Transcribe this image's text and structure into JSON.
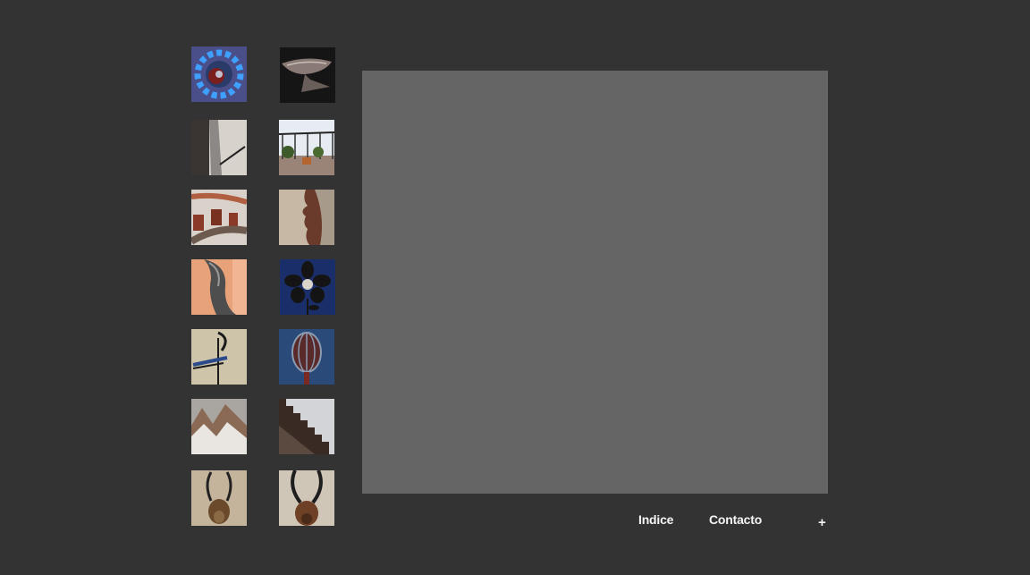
{
  "nav": {
    "index_label": "Indice",
    "contact_label": "Contacto",
    "more_label": "+"
  },
  "colors": {
    "background": "#333333",
    "viewer": "#656565",
    "link": "#f4f4f4"
  },
  "gallery": {
    "thumbnails": [
      {
        "subject": "blue-gear-sculpture"
      },
      {
        "subject": "metal-fish-sculpture"
      },
      {
        "subject": "metal-wall-relief"
      },
      {
        "subject": "terrace-railing"
      },
      {
        "subject": "curved-staircase-railing"
      },
      {
        "subject": "face-profile-relief"
      },
      {
        "subject": "bent-metal-sculpture"
      },
      {
        "subject": "metal-flower-sculpture"
      },
      {
        "subject": "abstract-figure-sculpture"
      },
      {
        "subject": "metal-sphere-sculpture"
      },
      {
        "subject": "zigzag-metal-piece"
      },
      {
        "subject": "staircase-steps"
      },
      {
        "subject": "antelope-head-sculpture"
      },
      {
        "subject": "horned-head-sculpture"
      }
    ]
  }
}
